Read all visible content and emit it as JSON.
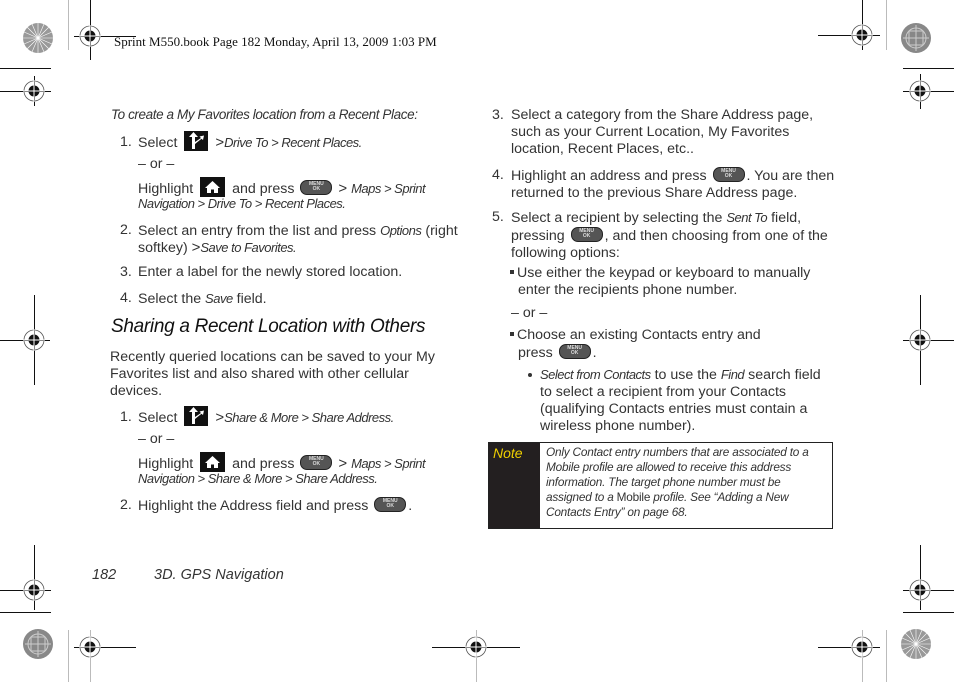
{
  "print_header": "Sprint M550.book  Page 182  Monday, April 13, 2009  1:03 PM",
  "left_column": {
    "intro": "To create a My Favorites location from a Recent Place:",
    "steps_a": [
      {
        "num": "1.",
        "pre": "Select",
        "icon": "navigation-arrow-icon",
        "path": "Drive To > Recent Places."
      },
      {
        "num": "2.",
        "text_pre": "Select an entry from the list and press ",
        "option": "Options",
        "text_mid": " (right",
        "line2_pre": "softkey) ",
        "line2_path": "Save to Favorites."
      },
      {
        "num": "3.",
        "text": "Enter a label for the newly stored location."
      },
      {
        "num": "4.",
        "text_pre": "Select the ",
        "field": "Save",
        "text_post": " field."
      }
    ],
    "or_1": "– or –",
    "alt_1": {
      "pre": "Highlight",
      "mid": "and press",
      "path1": "Maps > Sprint",
      "path2": "Navigation > Drive To > Recent Places."
    },
    "heading": "Sharing a Recent Location with Others",
    "paragraph": [
      "Recently queried locations can be saved to your My",
      "Favorites list and also shared with other cellular",
      "devices."
    ],
    "steps_b": [
      {
        "num": "1.",
        "pre": "Select",
        "path": "Share & More > Share Address."
      },
      {
        "num": "2.",
        "text": "Highlight the Address field and press"
      }
    ],
    "or_2": "– or –",
    "alt_2": {
      "pre": "Highlight",
      "mid": "and press",
      "path1": "Maps > Sprint",
      "path2": "Navigation > Share & More > Share Address."
    }
  },
  "right_column": {
    "step3": {
      "num": "3.",
      "lines": [
        "Select a category from the Share Address page,",
        "such as your Current Location, My Favorites",
        "location, Recent Places, etc.."
      ]
    },
    "step4": {
      "num": "4.",
      "line1_pre": "Highlight an address and press",
      "line1_post": ". You are then",
      "line2": "returned to the previous Share Address page."
    },
    "step5": {
      "num": "5.",
      "line1_pre": "Select a recipient by selecting the ",
      "field": "Sent To",
      "line1_post": " field,",
      "line2_pre": "pressing",
      "line2_post": ", and then choosing from one of the",
      "line3": "following options:"
    },
    "bullet1": [
      "Use either the keypad or keyboard to manually",
      "enter the recipients phone number."
    ],
    "or": "– or –",
    "bullet2": {
      "line1": "Choose an existing Contacts entry and",
      "line2_pre": "press",
      "line2_post": "."
    },
    "sub_bullet": {
      "em1": "Select from Contacts",
      "mid": " to use the ",
      "em2": "Find",
      "post": " search field",
      "lines": [
        "to select a recipient from your Contacts",
        "(qualifying Contacts entries must contain a",
        "wireless phone number)."
      ]
    }
  },
  "note": {
    "label": "Note",
    "lines": [
      "Only Contact entry numbers that are associated to a",
      "Mobile profile are allowed to receive this address",
      "information. The target phone number must be"
    ],
    "line4_pre": "assigned to a ",
    "line4_bold": "Mobile",
    "line4_post": " profile. See “Adding a New",
    "line5": "Contacts Entry” on page 68."
  },
  "footer": {
    "page_number": "182",
    "section": "3D. GPS Navigation"
  },
  "menu_key": {
    "top": "MENU",
    "bottom": "OK"
  },
  "colors": {
    "note_label_bg": "#231f20",
    "note_label_text": "#f0d000"
  }
}
